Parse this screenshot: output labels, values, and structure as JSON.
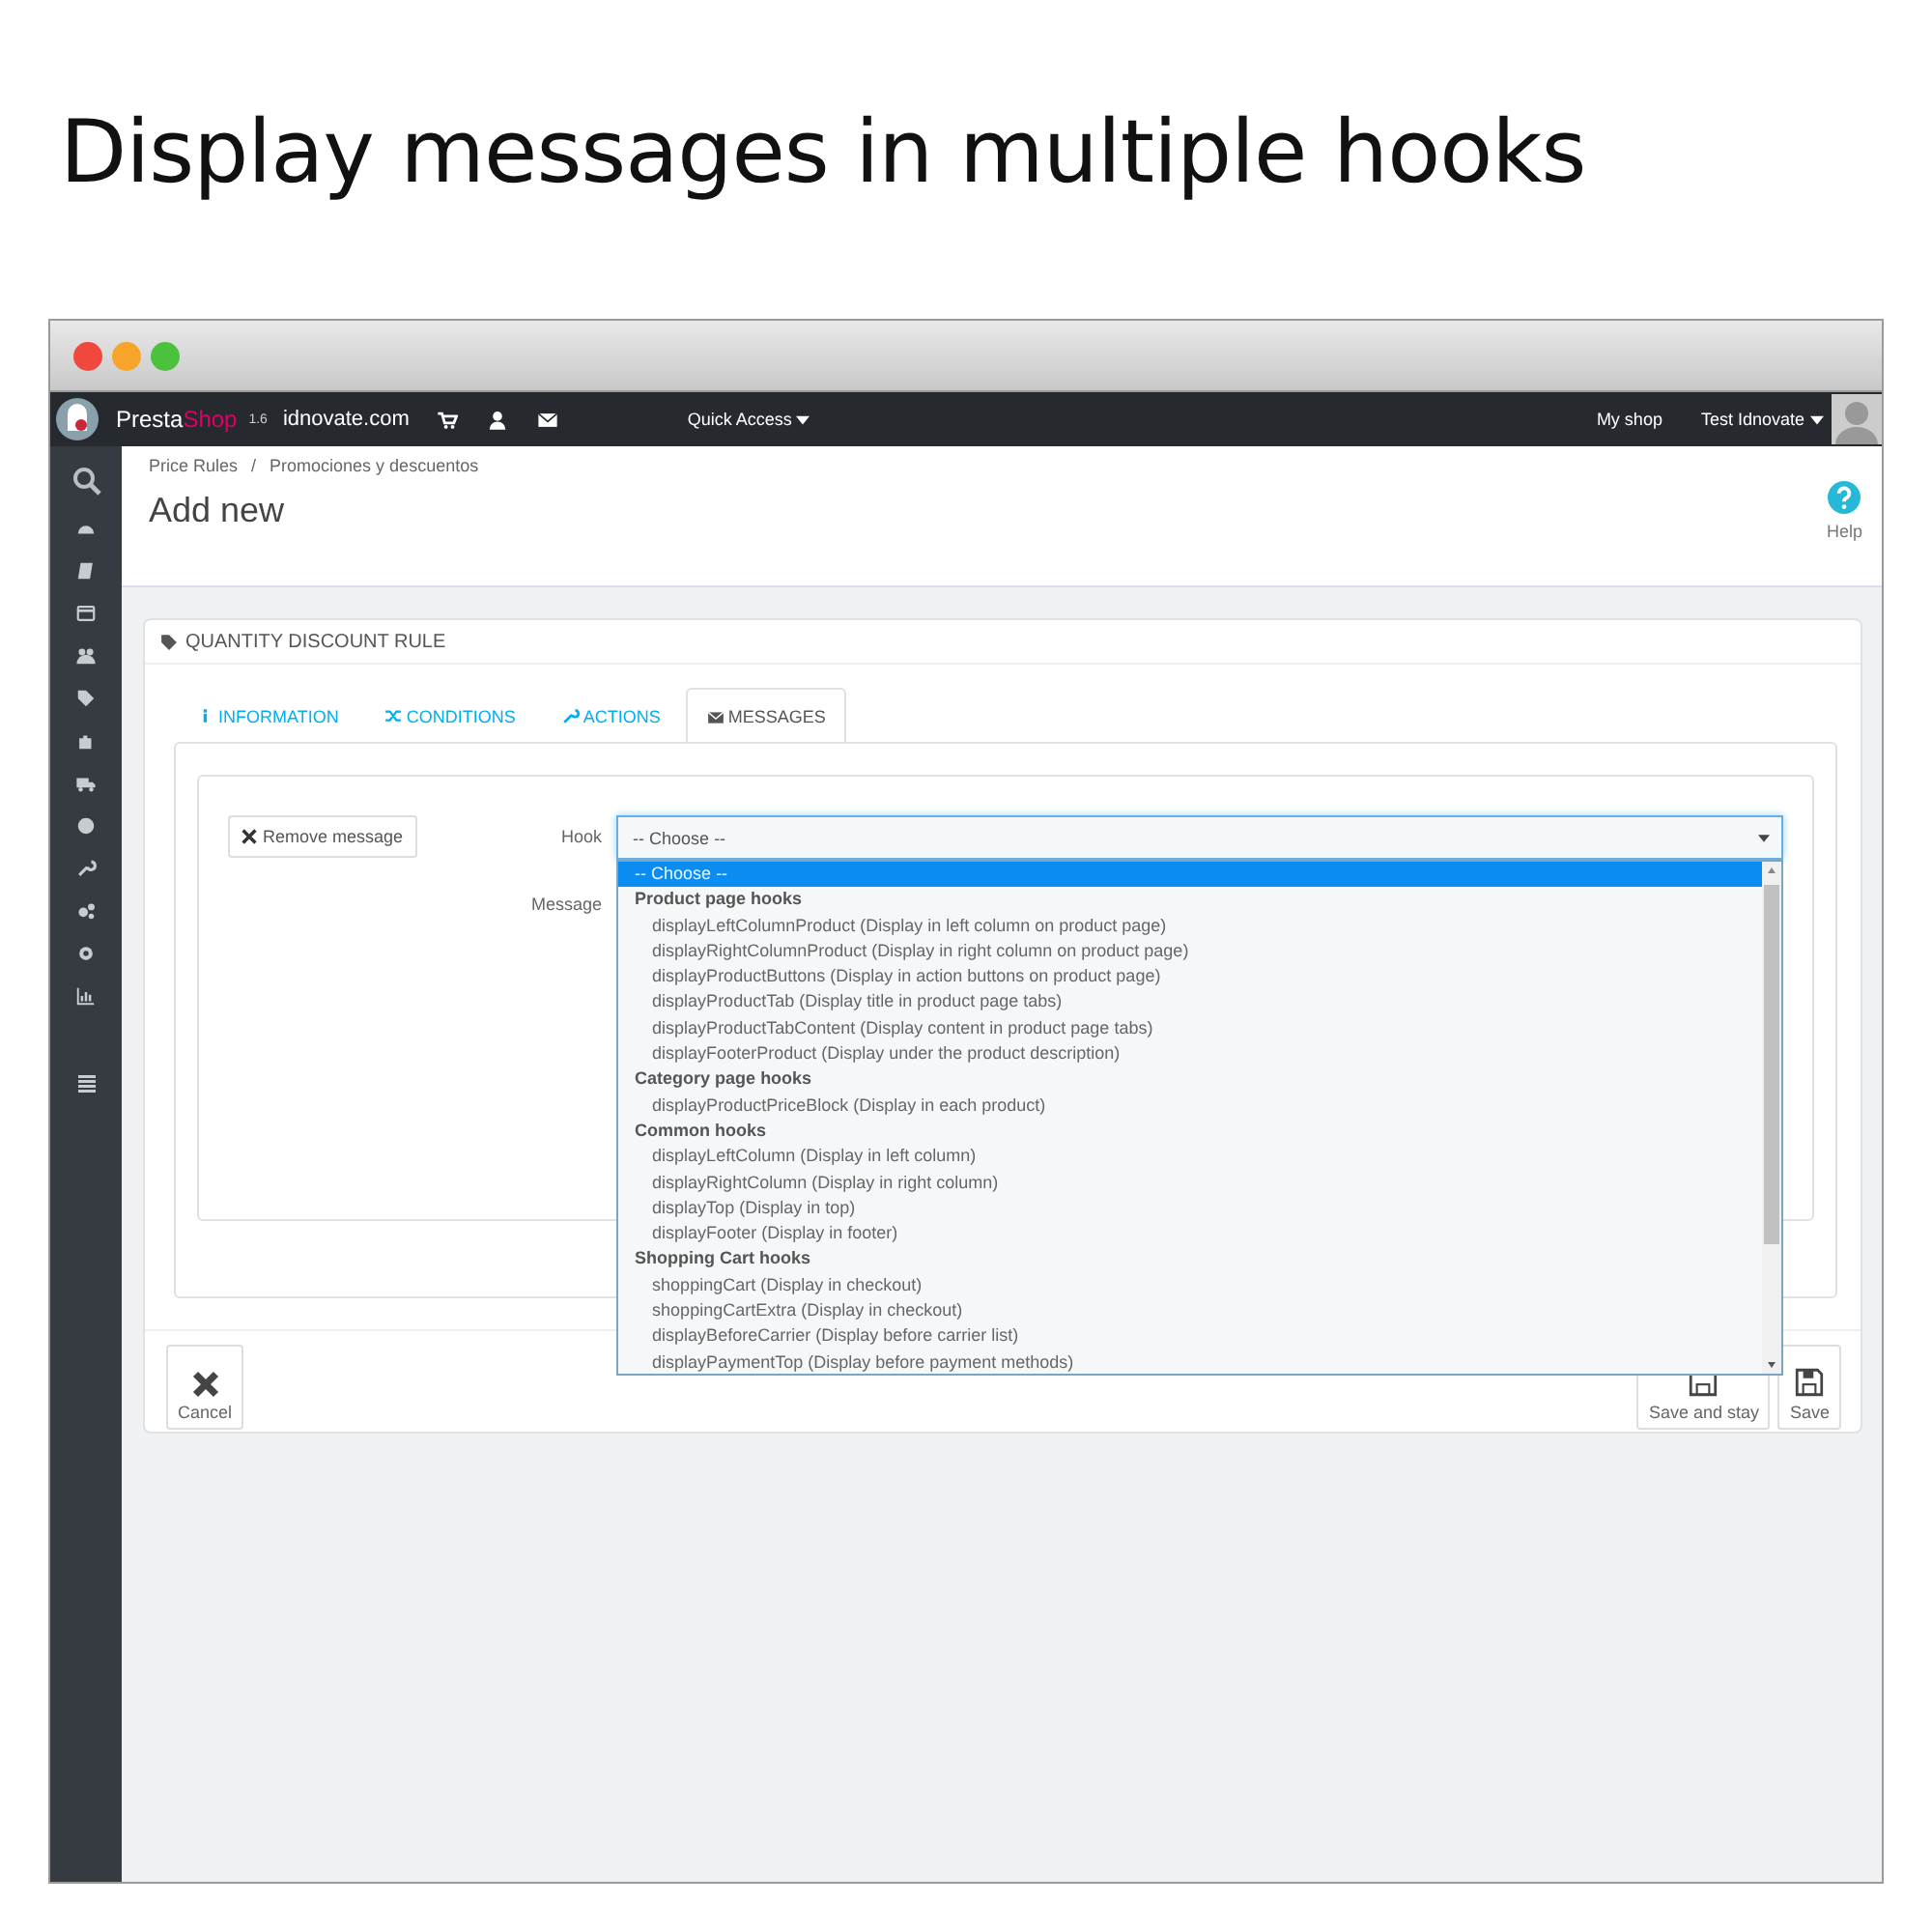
{
  "heading": "Display messages in multiple hooks",
  "topbar": {
    "brand": [
      "Presta",
      "Shop"
    ],
    "version": "1.6",
    "shop": "idnovate.com",
    "quick_access": "Quick Access",
    "my_shop": "My shop",
    "user": "Test Idnovate"
  },
  "breadcrumb": [
    "Price Rules",
    "Promociones y descuentos"
  ],
  "breadcrumb_separator": "/",
  "page_title": "Add new",
  "help": "Help",
  "panel": {
    "title": "QUANTITY DISCOUNT RULE",
    "tabs": [
      {
        "label": "INFORMATION",
        "selected": false
      },
      {
        "label": "CONDITIONS",
        "selected": false
      },
      {
        "label": "ACTIONS",
        "selected": false
      },
      {
        "label": "MESSAGES",
        "selected": true
      }
    ],
    "remove_button": "Remove message",
    "hook_label": "Hook",
    "hook_value": "-- Choose --",
    "message_label": "Message",
    "cancel": "Cancel",
    "save_and_stay": "Save and stay",
    "save": "Save"
  },
  "dropdown": {
    "options": [
      {
        "label": "-- Choose --",
        "selected": true
      }
    ],
    "groups": [
      {
        "label": "Product page hooks",
        "options": [
          {
            "label": "displayLeftColumnProduct (Display in left column on product page)",
            "selected": false
          },
          {
            "label": "displayRightColumnProduct (Display in right column on product page)",
            "selected": false
          },
          {
            "label": "displayProductButtons (Display in action buttons on product page)",
            "selected": false
          },
          {
            "label": "displayProductTab (Display title in product page tabs)",
            "selected": false
          },
          {
            "label": "displayProductTabContent (Display content in product page tabs)",
            "selected": false
          },
          {
            "label": "displayFooterProduct (Display under the product description)",
            "selected": false
          }
        ]
      },
      {
        "label": "Category page hooks",
        "options": [
          {
            "label": "displayProductPriceBlock (Display in each product)",
            "selected": false
          }
        ]
      },
      {
        "label": "Common hooks",
        "options": [
          {
            "label": "displayLeftColumn (Display in left column)",
            "selected": false
          },
          {
            "label": "displayRightColumn (Display in right column)",
            "selected": false
          },
          {
            "label": "displayTop (Display in top)",
            "selected": false
          },
          {
            "label": "displayFooter (Display in footer)",
            "selected": false
          }
        ]
      },
      {
        "label": "Shopping Cart hooks",
        "options": [
          {
            "label": "shoppingCart (Display in checkout)",
            "selected": false
          },
          {
            "label": "shoppingCartExtra (Display in checkout)",
            "selected": false
          },
          {
            "label": "displayBeforeCarrier (Display before carrier list)",
            "selected": false
          },
          {
            "label": "displayPaymentTop (Display before payment methods)",
            "selected": false
          }
        ]
      }
    ]
  }
}
